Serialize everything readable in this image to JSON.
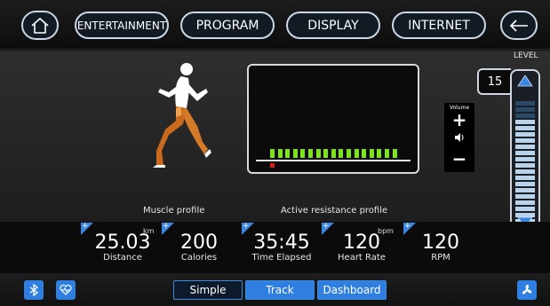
{
  "nav": {
    "entertainment": "ENTERTAINMENT",
    "program": "PROGRAM",
    "display": "DISPLAY",
    "internet": "INTERNET"
  },
  "main": {
    "muscle_profile_label": "Muscle profile",
    "active_resistance_label": "Active resistance profile",
    "resistance_segments_lit": 17,
    "volume": {
      "label": "Volume",
      "plus": "+",
      "minus": "−"
    },
    "level": {
      "label": "LEVEL",
      "value": "15"
    }
  },
  "stats": [
    {
      "value": "25.03",
      "unit": "km",
      "name": "Distance"
    },
    {
      "value": "200",
      "unit": "",
      "name": "Calories"
    },
    {
      "value": "35:45",
      "unit": "",
      "name": "Time Elapsed"
    },
    {
      "value": "120",
      "unit": "bpm",
      "name": "Heart Rate"
    },
    {
      "value": "120",
      "unit": "",
      "name": "RPM"
    }
  ],
  "bottom": {
    "tabs": [
      "Simple",
      "Track",
      "Dashboard"
    ],
    "active_tab": "Simple"
  },
  "colors": {
    "accent": "#2f7fe0",
    "segment_green": "#7ee21e",
    "marker_red": "#e01c1c"
  }
}
